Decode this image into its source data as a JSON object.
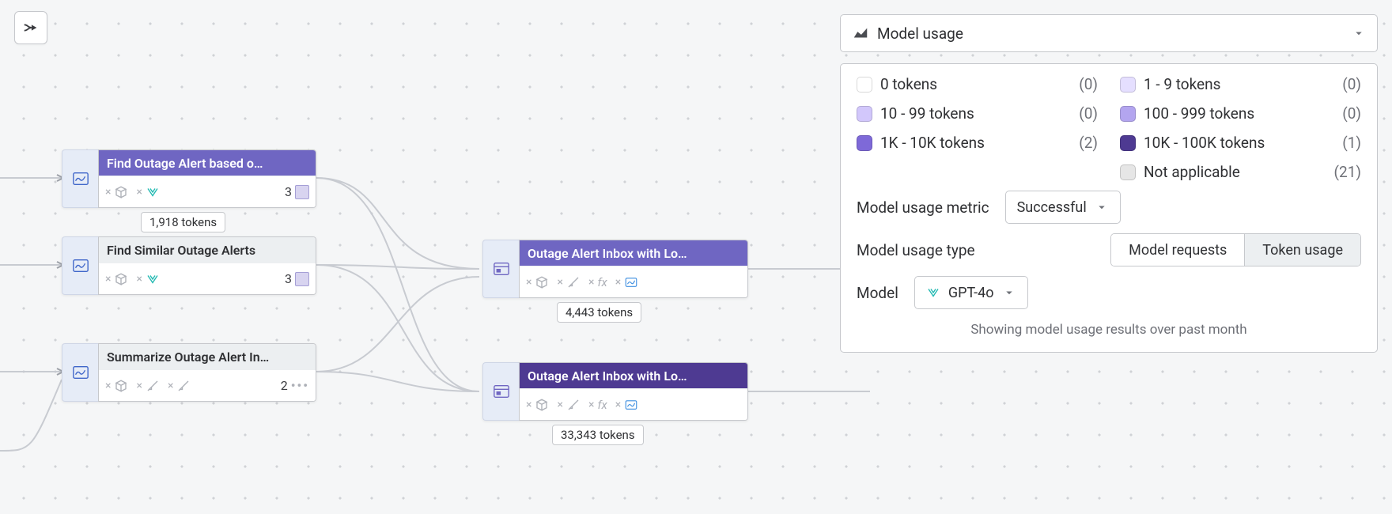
{
  "toolbar": {
    "pan_button": "pan-target-icon"
  },
  "nodes": {
    "n1": {
      "title": "Find Outage Alert based o…",
      "count": "3",
      "tokens": "1,918 tokens"
    },
    "n2": {
      "title": "Find Similar Outage Alerts",
      "count": "3"
    },
    "n3": {
      "title": "Summarize Outage Alert In…",
      "count": "2"
    },
    "n4": {
      "title": "Outage Alert Inbox with Lo…",
      "tokens": "4,443 tokens"
    },
    "n5": {
      "title": "Outage Alert Inbox with Lo…",
      "tokens": "33,343 tokens"
    }
  },
  "panel": {
    "dropdown_label": "Model usage",
    "legend": [
      {
        "color": "#ffffff",
        "label": "0 tokens",
        "count": "(0)"
      },
      {
        "color": "#e5dfff",
        "label": "1 - 9 tokens",
        "count": "(0)"
      },
      {
        "color": "#d2c7fb",
        "label": "10 - 99 tokens",
        "count": "(0)"
      },
      {
        "color": "#b3a5ef",
        "label": "100 - 999 tokens",
        "count": "(0)"
      },
      {
        "color": "#7e69d8",
        "label": "1K - 10K tokens",
        "count": "(2)"
      },
      {
        "color": "#4e3a92",
        "label": "10K - 100K tokens",
        "count": "(1)"
      },
      {
        "color": "",
        "label": "",
        "count": ""
      },
      {
        "color": "#e6e6e6",
        "label": "Not applicable",
        "count": "(21)"
      }
    ],
    "metric_label": "Model usage metric",
    "metric_value": "Successful",
    "type_label": "Model usage type",
    "type_options": {
      "requests": "Model requests",
      "token": "Token usage"
    },
    "model_label": "Model",
    "model_value": "GPT-4o",
    "footer": "Showing model usage results over past month"
  }
}
